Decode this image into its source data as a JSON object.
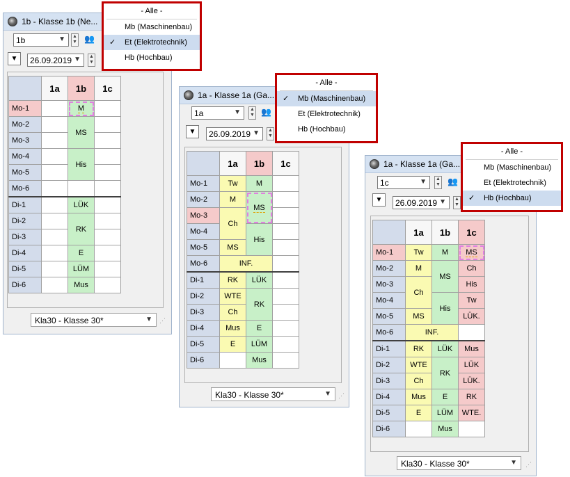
{
  "windows": [
    {
      "title": "1b - Klasse 1b (Ne...",
      "class_combo": "1b",
      "date": "26.09.2019",
      "columns": [
        "1a",
        "1b",
        "1c"
      ],
      "rows": [
        {
          "label": "Mo-1",
          "cells": [
            "",
            "M",
            ""
          ]
        },
        {
          "label": "Mo-2",
          "cells": [
            "",
            "",
            ""
          ]
        },
        {
          "label": "Mo-3",
          "cells": [
            "",
            "MS",
            ""
          ]
        },
        {
          "label": "Mo-4",
          "cells": [
            "",
            "",
            ""
          ]
        },
        {
          "label": "Mo-5",
          "cells": [
            "",
            "His",
            ""
          ]
        },
        {
          "label": "Mo-6",
          "cells": [
            "",
            "",
            ""
          ]
        },
        {
          "label": "Di-1",
          "cells": [
            "",
            "LÜK",
            ""
          ]
        },
        {
          "label": "Di-2",
          "cells": [
            "",
            "",
            ""
          ]
        },
        {
          "label": "Di-3",
          "cells": [
            "",
            "RK",
            ""
          ]
        },
        {
          "label": "Di-4",
          "cells": [
            "",
            "E",
            ""
          ]
        },
        {
          "label": "Di-5",
          "cells": [
            "",
            "LÜM",
            ""
          ]
        },
        {
          "label": "Di-6",
          "cells": [
            "",
            "Mus",
            ""
          ]
        }
      ],
      "footer": "Kla30 - Klasse 30*",
      "menu": {
        "selected": "Et (Elektrotechnik)"
      }
    },
    {
      "title": "1a - Klasse 1a (Ga...",
      "class_combo": "1a",
      "date": "26.09.2019",
      "columns": [
        "1a",
        "1b",
        "1c"
      ],
      "rows": [
        {
          "label": "Mo-1",
          "cells": [
            "Tw",
            "M",
            ""
          ]
        },
        {
          "label": "Mo-2",
          "cells": [
            "M",
            "MS",
            ""
          ]
        },
        {
          "label": "Mo-3",
          "cells": [
            "",
            "",
            ""
          ]
        },
        {
          "label": "Mo-4",
          "cells": [
            "Ch",
            "His",
            ""
          ]
        },
        {
          "label": "Mo-5",
          "cells": [
            "MS",
            "",
            ""
          ]
        },
        {
          "label": "Mo-6",
          "cells": [
            "INF.",
            "",
            ""
          ]
        },
        {
          "label": "Di-1",
          "cells": [
            "RK",
            "LÜK",
            ""
          ]
        },
        {
          "label": "Di-2",
          "cells": [
            "WTE",
            "RK",
            ""
          ]
        },
        {
          "label": "Di-3",
          "cells": [
            "Ch",
            "",
            ""
          ]
        },
        {
          "label": "Di-4",
          "cells": [
            "Mus",
            "E",
            ""
          ]
        },
        {
          "label": "Di-5",
          "cells": [
            "E",
            "LÜM",
            ""
          ]
        },
        {
          "label": "Di-6",
          "cells": [
            "",
            "Mus",
            ""
          ]
        }
      ],
      "footer": "Kla30 - Klasse 30*",
      "menu": {
        "selected": "Mb (Maschinenbau)"
      }
    },
    {
      "title": "1a - Klasse 1a (Ga...",
      "class_combo": "1c",
      "date": "26.09.2019",
      "columns": [
        "1a",
        "1b",
        "1c"
      ],
      "rows": [
        {
          "label": "Mo-1",
          "cells": [
            "Tw",
            "M",
            "MS"
          ]
        },
        {
          "label": "Mo-2",
          "cells": [
            "M",
            "MS",
            "Ch"
          ]
        },
        {
          "label": "Mo-3",
          "cells": [
            "",
            "",
            "His"
          ]
        },
        {
          "label": "Mo-4",
          "cells": [
            "Ch",
            "His",
            "Tw"
          ]
        },
        {
          "label": "Mo-5",
          "cells": [
            "MS",
            "",
            "LÜK."
          ]
        },
        {
          "label": "Mo-6",
          "cells": [
            "INF.",
            "",
            ""
          ]
        },
        {
          "label": "Di-1",
          "cells": [
            "RK",
            "LÜK",
            "Mus"
          ]
        },
        {
          "label": "Di-2",
          "cells": [
            "WTE",
            "RK",
            "LÜK"
          ]
        },
        {
          "label": "Di-3",
          "cells": [
            "Ch",
            "",
            "LÜK."
          ]
        },
        {
          "label": "Di-4",
          "cells": [
            "Mus",
            "E",
            "RK"
          ]
        },
        {
          "label": "Di-5",
          "cells": [
            "E",
            "LÜM",
            "WTE."
          ]
        },
        {
          "label": "Di-6",
          "cells": [
            "",
            "Mus",
            ""
          ]
        }
      ],
      "footer": "Kla30 - Klasse 30*",
      "menu": {
        "selected": "Hb (Hochbau)"
      }
    }
  ],
  "menu_items": [
    "- Alle -",
    "Mb (Maschinenbau)",
    "Et (Elektrotechnik)",
    "Hb (Hochbau)"
  ],
  "check_mark": "✓",
  "colors": {
    "yellow": "#fafab2",
    "green": "#c8f0c8",
    "red": "#f5caca",
    "row_label": "#d3dceb",
    "menu_border": "#c00000"
  }
}
